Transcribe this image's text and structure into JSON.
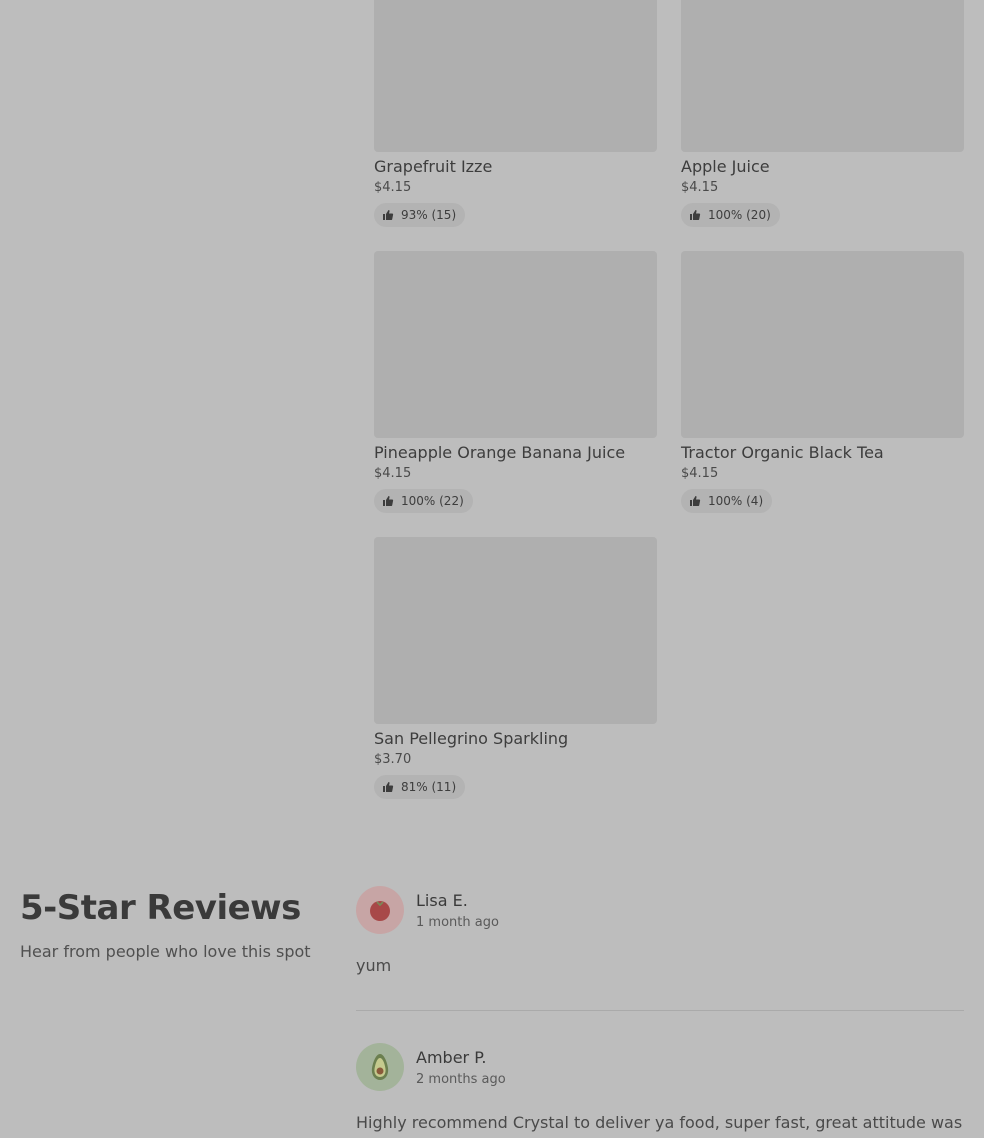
{
  "menu_items": [
    {
      "name": "Grapefruit Izze",
      "price": "$4.15",
      "rating": "93% (15)"
    },
    {
      "name": "Apple Juice",
      "price": "$4.15",
      "rating": "100% (20)"
    },
    {
      "name": "Pineapple Orange Banana Juice",
      "price": "$4.15",
      "rating": "100% (22)"
    },
    {
      "name": "Tractor Organic Black Tea",
      "price": "$4.15",
      "rating": "100% (4)"
    },
    {
      "name": "San Pellegrino Sparkling",
      "price": "$3.70",
      "rating": "81% (11)"
    }
  ],
  "reviews_section": {
    "title": "5-Star Reviews",
    "subtitle": "Hear from people who love this spot"
  },
  "reviews": [
    {
      "name": "Lisa E.",
      "when": "1 month ago",
      "text": "yum",
      "avatar_icon": "tomato-icon"
    },
    {
      "name": "Amber P.",
      "when": "2 months ago",
      "text": "Highly recommend Crystal to deliver ya food, super fast, great attitude was",
      "avatar_icon": "avocado-icon"
    }
  ]
}
